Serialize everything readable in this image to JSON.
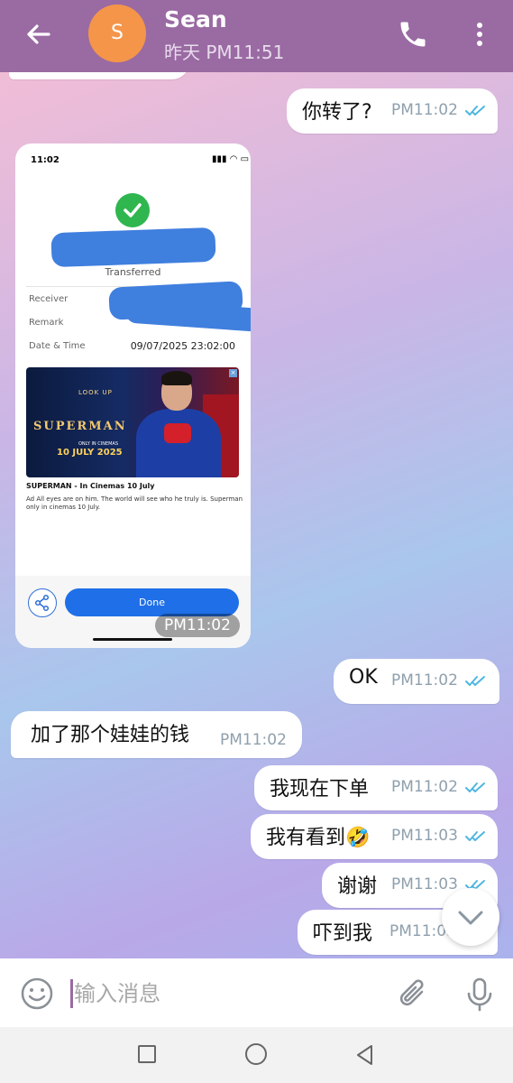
{
  "header": {
    "avatar_letter": "S",
    "name": "Sean",
    "status": "昨天 PM11:51",
    "back_icon": "arrow-left-icon",
    "call_icon": "phone-icon",
    "more_icon": "more-vertical-icon"
  },
  "messages": [
    {
      "direction": "out",
      "text": "你转了?",
      "time": "PM11:02",
      "read": true
    },
    {
      "direction": "in",
      "type": "image",
      "time": "PM11:02"
    },
    {
      "direction": "out",
      "text": "OK",
      "time": "PM11:02",
      "read": true
    },
    {
      "direction": "in",
      "text": "加了那个娃娃的钱",
      "time": "PM11:02"
    },
    {
      "direction": "out",
      "text": "我现在下单",
      "time": "PM11:02",
      "read": true
    },
    {
      "direction": "out",
      "text": "我有看到🤣",
      "time": "PM11:03",
      "read": true
    },
    {
      "direction": "out",
      "text": "谢谢",
      "time": "PM11:03",
      "read": true
    },
    {
      "direction": "out",
      "text": "吓到我",
      "time": "PM11:03",
      "read": true
    }
  ],
  "screenshot": {
    "status_time": "11:02",
    "status_icons": "▮▮▮ ◠ ▭",
    "transferred": "Transferred",
    "receiver_label": "Receiver",
    "remark_label": "Remark",
    "datetime_label": "Date & Time",
    "datetime_value": "09/07/2025 23:02:00",
    "ad": {
      "look_up": "LOOK UP",
      "superman": "SUPERMAN",
      "only_in_cinemas": "ONLY IN CINEMAS",
      "date": "10 JULY 2025",
      "title": "SUPERMAN - In Cinemas 10 July",
      "desc": "Ad  All eyes are on him. The world will see who he truly is. Superman only in cinemas 10 July."
    },
    "done_label": "Done"
  },
  "input": {
    "placeholder": "输入消息",
    "emoji_icon": "smiley-icon",
    "attach_icon": "paperclip-icon",
    "mic_icon": "microphone-icon"
  },
  "colors": {
    "header": "#9a6aa3",
    "avatar": "#f4954a",
    "read_check": "#4fb6e0",
    "time": "#8fa0ad"
  }
}
